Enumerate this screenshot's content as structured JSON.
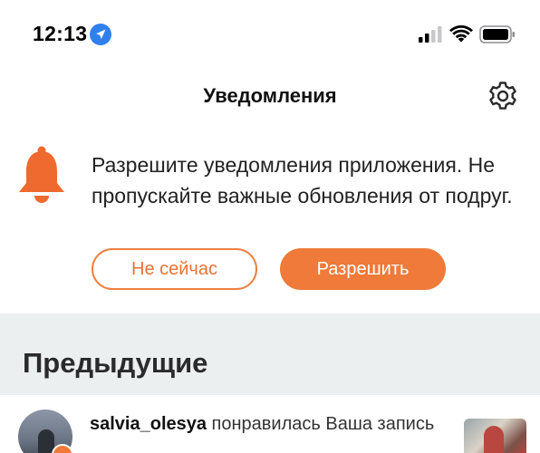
{
  "status_bar": {
    "time": "12:13",
    "icons": [
      "location-arrow-icon",
      "cellular-signal-icon",
      "wifi-icon",
      "battery-icon"
    ]
  },
  "header": {
    "title": "Уведомления",
    "settings_icon": "gear-icon"
  },
  "permission_prompt": {
    "icon": "bell-icon",
    "text": "Разрешите уведомления приложения. Не пропускайте важные обновления от подруг.",
    "later_label": "Не сейчас",
    "allow_label": "Разрешить"
  },
  "section": {
    "title": "Предыдущие"
  },
  "notifications": [
    {
      "username": "salvia_olesya",
      "action": " понравилась Ваша запись",
      "badge_icon": "heart-icon"
    }
  ],
  "colors": {
    "accent": "#ef7a39",
    "section_background": "#ebeff0",
    "location_blue": "#2f80ed"
  }
}
